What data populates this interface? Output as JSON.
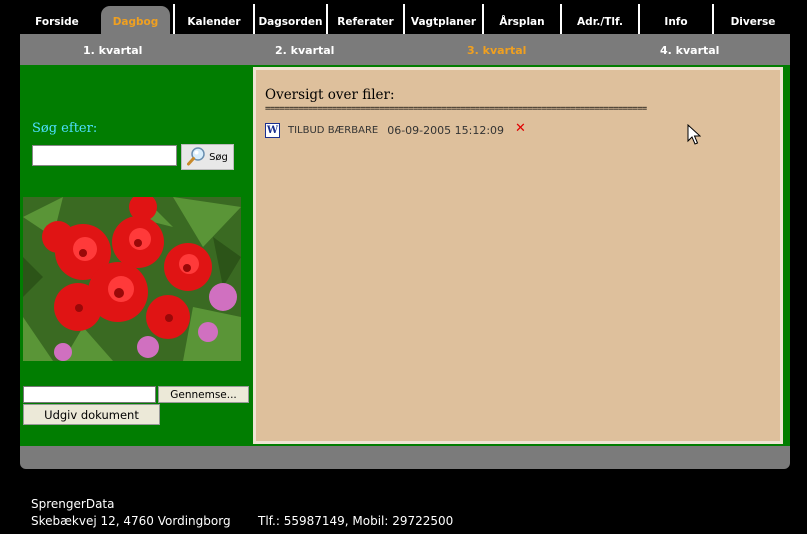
{
  "nav": {
    "tabs": [
      {
        "label": "Forside",
        "active": false
      },
      {
        "label": "Dagbog",
        "active": true
      },
      {
        "label": "Kalender",
        "active": false
      },
      {
        "label": "Dagsorden",
        "active": false
      },
      {
        "label": "Referater",
        "active": false
      },
      {
        "label": "Vagtplaner",
        "active": false
      },
      {
        "label": "Årsplan",
        "active": false
      },
      {
        "label": "Adr./Tlf.",
        "active": false
      },
      {
        "label": "Info",
        "active": false
      },
      {
        "label": "Diverse",
        "active": false
      }
    ]
  },
  "quarters": [
    {
      "label": "1. kvartal",
      "active": false
    },
    {
      "label": "2. kvartal",
      "active": false
    },
    {
      "label": "3. kvartal",
      "active": true
    },
    {
      "label": "4. kvartal",
      "active": false
    }
  ],
  "search": {
    "label": "Søg efter:",
    "value": "",
    "button_label": "Søg"
  },
  "upload": {
    "browse_label": "Gennemse...",
    "publish_label": "Udgiv dokument"
  },
  "files": {
    "title": "Oversigt over filer:",
    "rule": "================================================================================",
    "items": [
      {
        "name": "TILBUD BÆRBARE",
        "date": "06-09-2005 15:12:09",
        "icon": "word-document-icon"
      }
    ]
  },
  "footer": {
    "company": "SprengerData",
    "address": "Skebækvej 12, 4760 Vordingborg",
    "contact": "Tlf.: 55987149, Mobil: 29722500"
  },
  "colors": {
    "accent": "#f0a020",
    "green": "#017d01",
    "panel": "#dec09c",
    "bar": "#7b7b7b",
    "search_label": "#4fe0ff",
    "delete": "#e00000"
  }
}
